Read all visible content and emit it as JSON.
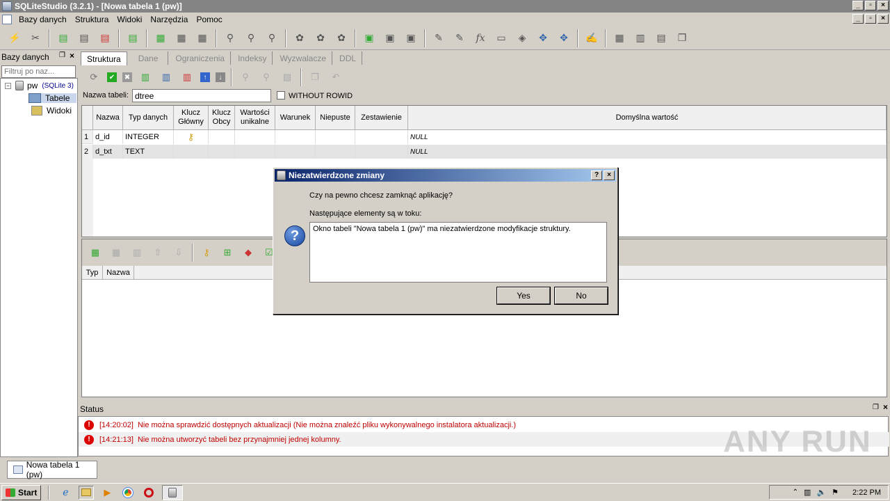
{
  "window": {
    "title": "SQLiteStudio (3.2.1) - [Nowa tabela 1 (pw)]"
  },
  "menu": [
    "Bazy danych",
    "Struktura",
    "Widoki",
    "Narzędzia",
    "Pomoc"
  ],
  "db_panel": {
    "title": "Bazy danych",
    "filter_placeholder": "Filtruj po naz...",
    "tree": {
      "db_name": "pw",
      "db_type": "(SQLite 3)",
      "tables": "Tabele",
      "views": "Widoki"
    }
  },
  "tabs": [
    "Struktura",
    "Dane",
    "Ograniczenia",
    "Indeksy",
    "Wyzwalacze",
    "DDL"
  ],
  "table_editor": {
    "name_label": "Nazwa tabeli:",
    "name_value": "dtree",
    "without_rowid": "WITHOUT ROWID",
    "columns": [
      "Nazwa",
      "Typ danych",
      "Klucz Główny",
      "Klucz Obcy",
      "Wartości unikalne",
      "Warunek",
      "Niepuste",
      "Zestawienie",
      "Domyślna wartość"
    ],
    "rows": [
      {
        "num": "1",
        "name": "d_id",
        "type": "INTEGER",
        "default": "NULL"
      },
      {
        "num": "2",
        "name": "d_txt",
        "type": "TEXT",
        "default": "NULL"
      }
    ]
  },
  "constraints": {
    "columns": [
      "Typ",
      "Nazwa"
    ]
  },
  "status": {
    "title": "Status",
    "messages": [
      {
        "time": "[14:20:02]",
        "text": "Nie można sprawdzić dostępnych aktualizacji (Nie można znaleźć pliku wykonywalnego instalatora aktualizacji.)"
      },
      {
        "time": "[14:21:13]",
        "text": "Nie można utworzyć tabeli bez przynajmniej jednej kolumny."
      }
    ]
  },
  "window_tab": "Nowa tabela 1 (pw)",
  "dialog": {
    "title": "Niezatwierdzone zmiany",
    "question": "Czy na pewno chcesz zamknąć aplikację?",
    "pending_label": "Następujące elementy są w toku:",
    "pending_item": "Okno tabeli \"Nowa tabela 1 (pw)\" ma niezatwierdzone modyfikacje struktury.",
    "yes": "Yes",
    "no": "No"
  },
  "taskbar": {
    "start": "Start",
    "clock": "2:22 PM"
  },
  "watermark": "ANY RUN"
}
